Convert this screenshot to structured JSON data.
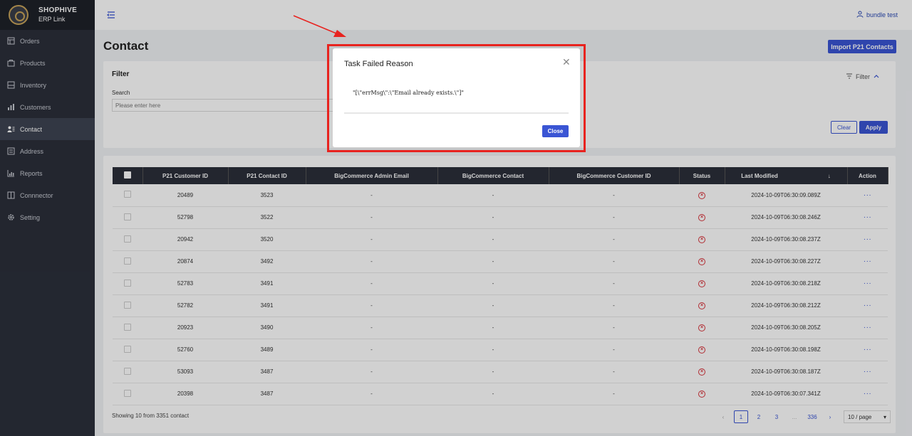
{
  "brand": {
    "name": "SHOPHIVE",
    "sub": "ERP Link"
  },
  "sidebar": {
    "items": [
      {
        "label": "Orders",
        "icon": "orders-icon",
        "active": false
      },
      {
        "label": "Products",
        "icon": "products-icon",
        "active": false
      },
      {
        "label": "Inventory",
        "icon": "inventory-icon",
        "active": false
      },
      {
        "label": "Customers",
        "icon": "customers-icon",
        "active": false
      },
      {
        "label": "Contact",
        "icon": "contact-icon",
        "active": true
      },
      {
        "label": "Address",
        "icon": "address-icon",
        "active": false
      },
      {
        "label": "Reports",
        "icon": "reports-icon",
        "active": false
      },
      {
        "label": "Connnector",
        "icon": "connector-icon",
        "active": false
      },
      {
        "label": "Setting",
        "icon": "gear-icon",
        "active": false
      }
    ]
  },
  "header": {
    "user": "bundle test"
  },
  "page": {
    "title": "Contact",
    "import_label": "Import P21 Contacts"
  },
  "filter": {
    "title": "Filter",
    "toggle_label": "Filter",
    "search_label": "Search",
    "search_placeholder": "Please enter here",
    "clear_label": "Clear",
    "apply_label": "Apply"
  },
  "table": {
    "headers": [
      "P21 Customer ID",
      "P21 Contact ID",
      "BigCommerce Admin Email",
      "BigCommerce Contact",
      "BigCommerce Customer ID",
      "Status",
      "Last Modified",
      "Action"
    ],
    "rows": [
      {
        "customer_id": "20489",
        "contact_id": "3523",
        "email": "-",
        "contact": "-",
        "bc_customer_id": "-",
        "status": "failed",
        "modified": "2024-10-09T06:30:09.089Z",
        "action": "···"
      },
      {
        "customer_id": "52798",
        "contact_id": "3522",
        "email": "-",
        "contact": "-",
        "bc_customer_id": "-",
        "status": "failed",
        "modified": "2024-10-09T06:30:08.246Z",
        "action": "···"
      },
      {
        "customer_id": "20942",
        "contact_id": "3520",
        "email": "-",
        "contact": "-",
        "bc_customer_id": "-",
        "status": "failed",
        "modified": "2024-10-09T06:30:08.237Z",
        "action": "···"
      },
      {
        "customer_id": "20874",
        "contact_id": "3492",
        "email": "-",
        "contact": "-",
        "bc_customer_id": "-",
        "status": "failed",
        "modified": "2024-10-09T06:30:08.227Z",
        "action": "···"
      },
      {
        "customer_id": "52783",
        "contact_id": "3491",
        "email": "-",
        "contact": "-",
        "bc_customer_id": "-",
        "status": "failed",
        "modified": "2024-10-09T06:30:08.218Z",
        "action": "···"
      },
      {
        "customer_id": "52782",
        "contact_id": "3491",
        "email": "-",
        "contact": "-",
        "bc_customer_id": "-",
        "status": "failed",
        "modified": "2024-10-09T06:30:08.212Z",
        "action": "···"
      },
      {
        "customer_id": "20923",
        "contact_id": "3490",
        "email": "-",
        "contact": "-",
        "bc_customer_id": "-",
        "status": "failed",
        "modified": "2024-10-09T06:30:08.205Z",
        "action": "···"
      },
      {
        "customer_id": "52760",
        "contact_id": "3489",
        "email": "-",
        "contact": "-",
        "bc_customer_id": "-",
        "status": "failed",
        "modified": "2024-10-09T06:30:08.198Z",
        "action": "···"
      },
      {
        "customer_id": "53093",
        "contact_id": "3487",
        "email": "-",
        "contact": "-",
        "bc_customer_id": "-",
        "status": "failed",
        "modified": "2024-10-09T06:30:08.187Z",
        "action": "···"
      },
      {
        "customer_id": "20398",
        "contact_id": "3487",
        "email": "-",
        "contact": "-",
        "bc_customer_id": "-",
        "status": "failed",
        "modified": "2024-10-09T06:30:07.341Z",
        "action": "···"
      }
    ]
  },
  "footer": {
    "count_text": "Showing 10 from 3351 contact",
    "pages": [
      "1",
      "2",
      "3",
      "...",
      "336"
    ],
    "current_page": "1",
    "page_size": "10 / page"
  },
  "modal": {
    "title": "Task Failed Reason",
    "message": "\"[\\\"errMsg\\\":\\\"Email already exists.\\\"]\"",
    "close_label": "Close"
  },
  "colors": {
    "accent": "#3a55d4",
    "sidebar": "#2b2f3a",
    "error": "#d9363e",
    "highlight": "#e8231f"
  }
}
